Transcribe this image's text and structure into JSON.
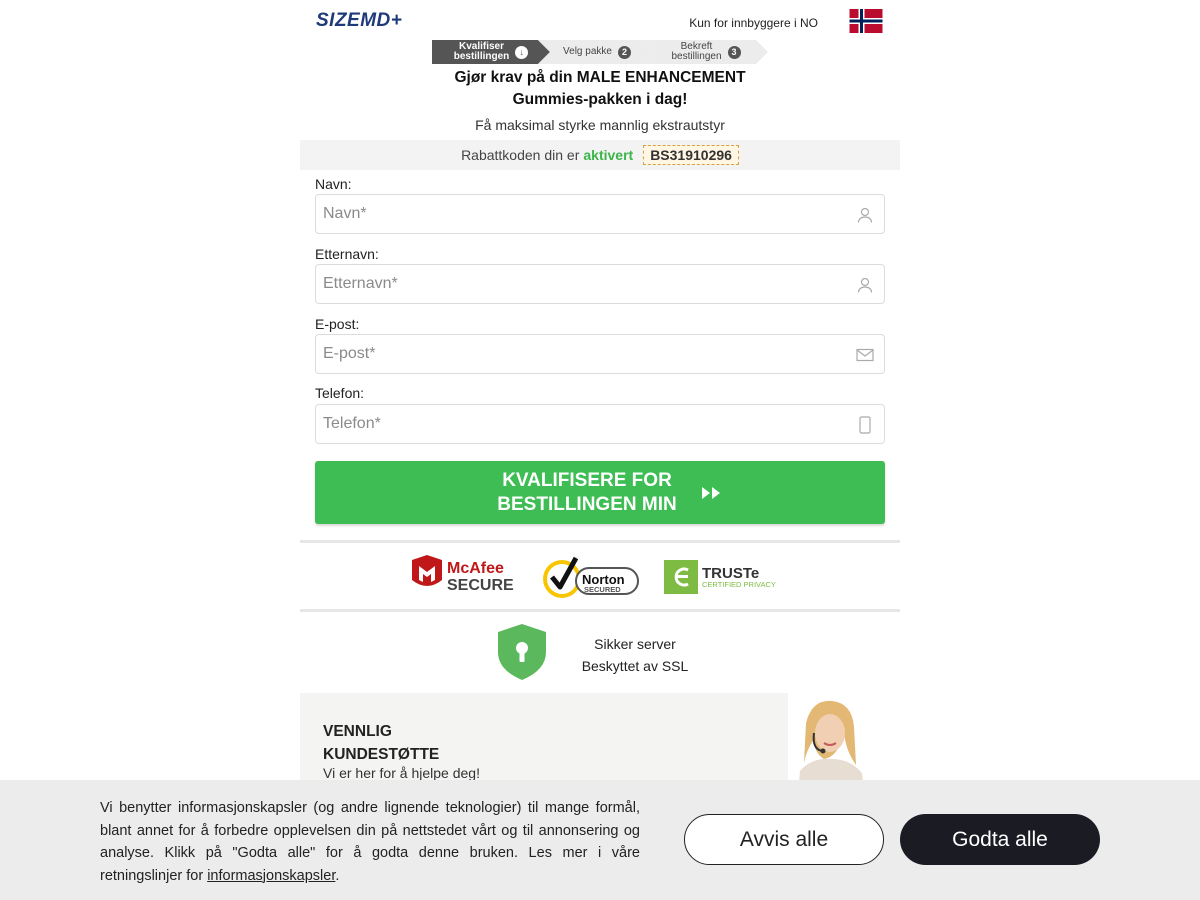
{
  "header": {
    "logo": "SIZEMD+",
    "country_note": "Kun for innbyggere i NO",
    "flag_icon": "norway-flag-icon"
  },
  "steps": [
    {
      "label_line1": "Kvalifiser",
      "label_line2": "bestillingen",
      "marker": "↓",
      "active": true
    },
    {
      "label_line1": "Velg pakke",
      "label_line2": "",
      "marker": "2",
      "active": false
    },
    {
      "label_line1": "Bekreft",
      "label_line2": "bestillingen",
      "marker": "3",
      "active": false
    }
  ],
  "headline": {
    "line1": "Gjør krav på din MALE ENHANCEMENT",
    "line2": "Gummies-pakken i dag!",
    "subline": "Få maksimal styrke mannlig ekstrautstyr"
  },
  "promo": {
    "prefix": "Rabattkoden din er",
    "status": "aktivert",
    "code": "BS31910296",
    "status_color": "#3db44a"
  },
  "form": {
    "first_name": {
      "label": "Navn:",
      "placeholder": "Navn*",
      "icon": "user-icon"
    },
    "last_name": {
      "label": "Etternavn:",
      "placeholder": "Etternavn*",
      "icon": "user-icon"
    },
    "email": {
      "label": "E-post:",
      "placeholder": "E-post*",
      "icon": "envelope-icon"
    },
    "phone": {
      "label": "Telefon:",
      "placeholder": "Telefon*",
      "icon": "phone-icon"
    },
    "submit_line1": "KVALIFISERE FOR",
    "submit_line2": "BESTILLINGEN MIN",
    "submit_color": "#3dbd53"
  },
  "trust_badges": {
    "mcafee": {
      "line1": "McAfee",
      "line2": "SECURE"
    },
    "norton": {
      "line1": "Norton",
      "line2": "SECURED"
    },
    "truste": {
      "line1": "TRUSTe",
      "line2": "CERTIFIED PRIVACY"
    }
  },
  "ssl": {
    "line1": "Sikker server",
    "line2": "Beskyttet av SSL",
    "icon": "shield-lock-icon",
    "color": "#5cb85c"
  },
  "support": {
    "title_line1": "VENNLIG",
    "title_line2": "KUNDESTØTTE",
    "subtitle": "Vi er her for å hjelpe deg!"
  },
  "cookie_banner": {
    "text": "Vi benytter informasjonskapsler (og andre lignende teknologier) til mange formål, blant annet for å forbedre opplevelsen din på nettstedet vårt og til annonsering og analyse. Klikk på \"Godta alle\" for å godta denne bruken. Les mer i våre retningslinjer for",
    "link_text": "informasjonskapsler",
    "trailing": ".",
    "reject_label": "Avvis alle",
    "accept_label": "Godta alle"
  }
}
